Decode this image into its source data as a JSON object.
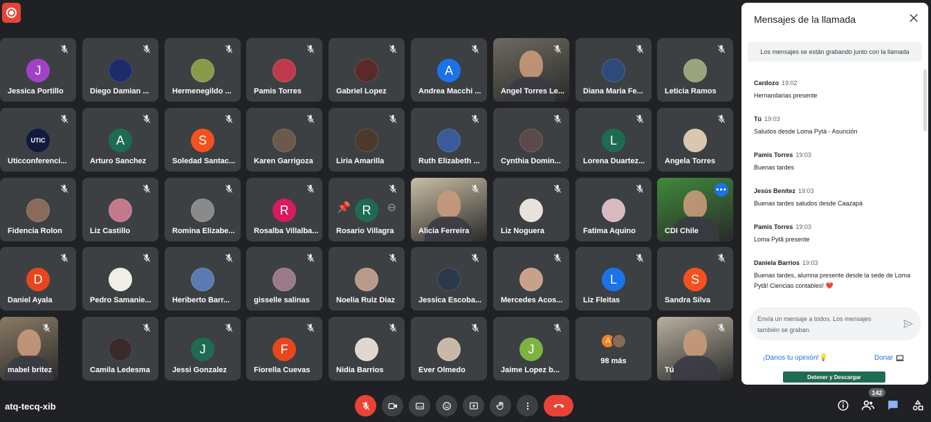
{
  "meeting": {
    "code": "atq-tecq-xib"
  },
  "colors": {
    "background": "#202124",
    "tile": "#3c4043",
    "accent": "#1a73e8",
    "danger": "#ea4335"
  },
  "participants": [
    {
      "name": "Jessica Portillo",
      "initial": "J",
      "color": "#a142c6"
    },
    {
      "name": "Diego Damian ...",
      "initial": "",
      "color": "#1d2a6b"
    },
    {
      "name": "Hermenegildo ...",
      "initial": "",
      "color": "#8a9a4a"
    },
    {
      "name": "Pamis Torres",
      "initial": "",
      "color": "#c0394a"
    },
    {
      "name": "Gabriel Lopez",
      "initial": "",
      "color": "#5a2a2a"
    },
    {
      "name": "Andrea Macchi ...",
      "initial": "A",
      "color": "#1a73e8"
    },
    {
      "name": "Angel Torres Le...",
      "initial": "",
      "color": "",
      "video": true,
      "videoColor": "#6d6a5f"
    },
    {
      "name": "Diana Maria Fe...",
      "initial": "",
      "color": "#2d4a7a"
    },
    {
      "name": "Leticia Ramos",
      "initial": "",
      "color": "#9aa37a"
    },
    {
      "name": "Uticconferenci...",
      "initial": "UTIC",
      "color": "#0f1a3d"
    },
    {
      "name": "Arturo Sanchez",
      "initial": "A",
      "color": "#1e6b52"
    },
    {
      "name": "Soledad Santac...",
      "initial": "S",
      "color": "#f4511e"
    },
    {
      "name": "Karen Garrigoza",
      "initial": "",
      "color": "#6b5a4a"
    },
    {
      "name": "Liria Amarilla",
      "initial": "",
      "color": "#4a3a2a"
    },
    {
      "name": "Ruth Elizabeth ...",
      "initial": "",
      "color": "#3a5a9a"
    },
    {
      "name": "Cynthia Domin...",
      "initial": "",
      "color": "#5a4a4a"
    },
    {
      "name": "Lorena Duartez...",
      "initial": "L",
      "color": "#1e6b52"
    },
    {
      "name": "Angela Torres",
      "initial": "",
      "color": "#d9c7b0"
    },
    {
      "name": "Fidencia Rolon",
      "initial": "",
      "color": "#8a6a5a"
    },
    {
      "name": "Liz Castillo",
      "initial": "",
      "color": "#c27a8a"
    },
    {
      "name": "Romina Elizabe...",
      "initial": "",
      "color": "#8a8a8a"
    },
    {
      "name": "Rosalba Villalba...",
      "initial": "R",
      "color": "#d81b60"
    },
    {
      "name": "Rosario Villagra",
      "initial": "R",
      "color": "#1e6b52",
      "hover": true
    },
    {
      "name": "Alicia Ferreira",
      "initial": "",
      "color": "",
      "video": true,
      "videoColor": "#c9bda6"
    },
    {
      "name": "Liz Noguera",
      "initial": "",
      "color": "#e8e2dc"
    },
    {
      "name": "Fatima Aquino",
      "initial": "",
      "color": "#d9b8c0"
    },
    {
      "name": "CDI Chile",
      "initial": "",
      "color": "",
      "video": true,
      "videoColor": "#3f8a3a",
      "highlight": true
    },
    {
      "name": "Daniel Ayala",
      "initial": "D",
      "color": "#e8461c"
    },
    {
      "name": "Pedro Samanie...",
      "initial": "",
      "color": "#f2efe9"
    },
    {
      "name": "Heriberto Barr...",
      "initial": "",
      "color": "#5a7ab0"
    },
    {
      "name": "gisselle salinas",
      "initial": "",
      "color": "#9a7a8a"
    },
    {
      "name": "Noelia Ruiz Diaz",
      "initial": "",
      "color": "#b89a8a"
    },
    {
      "name": "Jessica Escoba...",
      "initial": "",
      "color": "#2a3a4a"
    },
    {
      "name": "Mercedes Acos...",
      "initial": "",
      "color": "#c9a08a"
    },
    {
      "name": "Liz Fleitas",
      "initial": "L",
      "color": "#1a73e8"
    },
    {
      "name": "Sandra Silva",
      "initial": "S",
      "color": "#f4511e"
    },
    {
      "name": "mabel britez",
      "initial": "",
      "color": "",
      "video": true,
      "videoColor": "#8a7a64",
      "partial": true
    },
    {
      "name": "Camila Ledesma",
      "initial": "",
      "color": "#3a2a2a"
    },
    {
      "name": "Jessi Gonzalez",
      "initial": "J",
      "color": "#1e6b52"
    },
    {
      "name": "Fiorella Cuevas",
      "initial": "F",
      "color": "#e8461c"
    },
    {
      "name": "Nidia Barrios",
      "initial": "",
      "color": "#e0d8d0"
    },
    {
      "name": "Ever Olmedo",
      "initial": "",
      "color": "#c9b8a8"
    },
    {
      "name": "Jaime Lopez b...",
      "initial": "J",
      "color": "#7cb342"
    },
    {
      "name": "98 más",
      "initial": "A",
      "color": "#f4811e",
      "more": true
    },
    {
      "name": "Tú",
      "initial": "",
      "color": "",
      "video": true,
      "videoColor": "#b8b0a0"
    }
  ],
  "chat": {
    "title": "Mensajes de la llamada",
    "notice": "Los mensajes se están grabando junto con la llamada",
    "messages": [
      {
        "sender": "Cardozo",
        "time": "19:02",
        "text": "Hernandarias presente"
      },
      {
        "sender": "Tú",
        "time": "19:03",
        "text": "Saludos desde Loma Pytá - Asunción"
      },
      {
        "sender": "Pamis Torres",
        "time": "19:03",
        "text": "Buenas tardes"
      },
      {
        "sender": "Jesús Benítez",
        "time": "19:03",
        "text": "Buenas tardes saludos desde Caazapá"
      },
      {
        "sender": "Pamis Torres",
        "time": "19:03",
        "text": "Loma Pytã presente"
      },
      {
        "sender": "Daniela Barrios",
        "time": "19:03",
        "text": "Buenas tardes, alumna presente desde la sede de Loma Pytã! Ciencias contables! ❤️"
      }
    ],
    "input_placeholder": "Envía un mensaje a todos. Los mensajes también se graban.",
    "feedback": "¡Danos tu opinión!",
    "donate": "Donar",
    "stop_button": "Detener y Descargar"
  },
  "people_count": "142",
  "controls": [
    "microphone-off",
    "camera",
    "captions",
    "emoji",
    "present",
    "raise-hand",
    "more-options",
    "leave-call"
  ],
  "right_controls": [
    "info",
    "people",
    "chat",
    "activities"
  ]
}
